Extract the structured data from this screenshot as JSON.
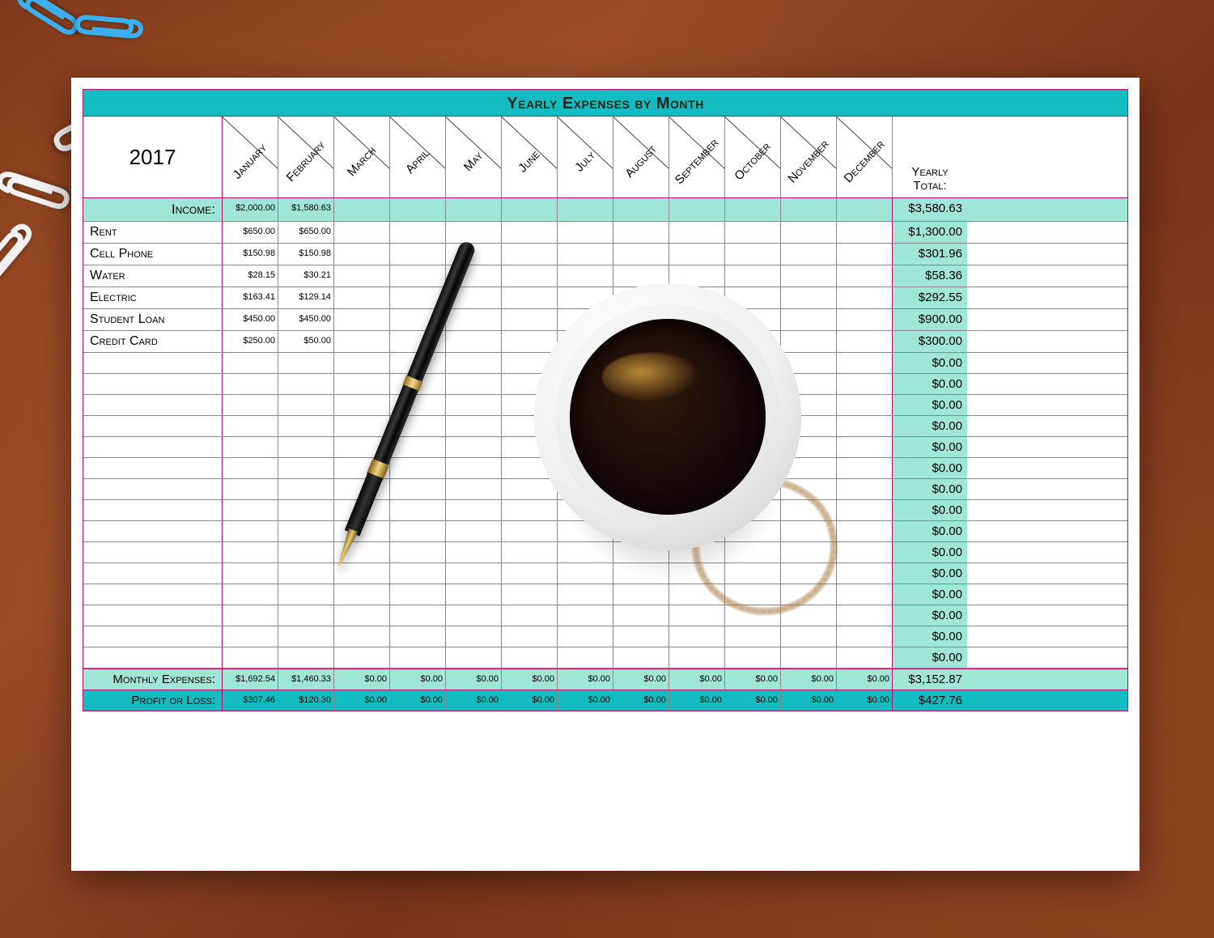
{
  "title": "Yearly Expenses by Month",
  "year": "2017",
  "months": [
    "January",
    "February",
    "March",
    "April",
    "May",
    "June",
    "July",
    "August",
    "September",
    "October",
    "November",
    "December"
  ],
  "total_head": {
    "line1": "Yearly",
    "line2": "Total:"
  },
  "income": {
    "label": "Income:",
    "values": [
      "$2,000.00",
      "$1,580.63",
      "",
      "",
      "",
      "",
      "",
      "",
      "",
      "",
      "",
      ""
    ],
    "total": "$3,580.63"
  },
  "expenses": [
    {
      "label": "Rent",
      "values": [
        "$650.00",
        "$650.00",
        "",
        "",
        "",
        "",
        "",
        "",
        "",
        "",
        "",
        ""
      ],
      "total": "$1,300.00"
    },
    {
      "label": "Cell Phone",
      "values": [
        "$150.98",
        "$150.98",
        "",
        "",
        "",
        "",
        "",
        "",
        "",
        "",
        "",
        ""
      ],
      "total": "$301.96"
    },
    {
      "label": "Water",
      "values": [
        "$28.15",
        "$30.21",
        "",
        "",
        "",
        "",
        "",
        "",
        "",
        "",
        "",
        ""
      ],
      "total": "$58.36"
    },
    {
      "label": "Electric",
      "values": [
        "$163.41",
        "$129.14",
        "",
        "",
        "",
        "",
        "",
        "",
        "",
        "",
        "",
        ""
      ],
      "total": "$292.55"
    },
    {
      "label": "Student Loan",
      "values": [
        "$450.00",
        "$450.00",
        "",
        "",
        "",
        "",
        "",
        "",
        "",
        "",
        "",
        ""
      ],
      "total": "$900.00"
    },
    {
      "label": "Credit Card",
      "values": [
        "$250.00",
        "$50.00",
        "",
        "",
        "",
        "",
        "",
        "",
        "",
        "",
        "",
        ""
      ],
      "total": "$300.00"
    },
    {
      "label": "",
      "values": [
        "",
        "",
        "",
        "",
        "",
        "",
        "",
        "",
        "",
        "",
        "",
        ""
      ],
      "total": "$0.00"
    },
    {
      "label": "",
      "values": [
        "",
        "",
        "",
        "",
        "",
        "",
        "",
        "",
        "",
        "",
        "",
        ""
      ],
      "total": "$0.00"
    },
    {
      "label": "",
      "values": [
        "",
        "",
        "",
        "",
        "",
        "",
        "",
        "",
        "",
        "",
        "",
        ""
      ],
      "total": "$0.00"
    },
    {
      "label": "",
      "values": [
        "",
        "",
        "",
        "",
        "",
        "",
        "",
        "",
        "",
        "",
        "",
        ""
      ],
      "total": "$0.00"
    },
    {
      "label": "",
      "values": [
        "",
        "",
        "",
        "",
        "",
        "",
        "",
        "",
        "",
        "",
        "",
        ""
      ],
      "total": "$0.00"
    },
    {
      "label": "",
      "values": [
        "",
        "",
        "",
        "",
        "",
        "",
        "",
        "",
        "",
        "",
        "",
        ""
      ],
      "total": "$0.00"
    },
    {
      "label": "",
      "values": [
        "",
        "",
        "",
        "",
        "",
        "",
        "",
        "",
        "",
        "",
        "",
        ""
      ],
      "total": "$0.00"
    },
    {
      "label": "",
      "values": [
        "",
        "",
        "",
        "",
        "",
        "",
        "",
        "",
        "",
        "",
        "",
        ""
      ],
      "total": "$0.00"
    },
    {
      "label": "",
      "values": [
        "",
        "",
        "",
        "",
        "",
        "",
        "",
        "",
        "",
        "",
        "",
        ""
      ],
      "total": "$0.00"
    },
    {
      "label": "",
      "values": [
        "",
        "",
        "",
        "",
        "",
        "",
        "",
        "",
        "",
        "",
        "",
        ""
      ],
      "total": "$0.00"
    },
    {
      "label": "",
      "values": [
        "",
        "",
        "",
        "",
        "",
        "",
        "",
        "",
        "",
        "",
        "",
        ""
      ],
      "total": "$0.00"
    },
    {
      "label": "",
      "values": [
        "",
        "",
        "",
        "",
        "",
        "",
        "",
        "",
        "",
        "",
        "",
        ""
      ],
      "total": "$0.00"
    },
    {
      "label": "",
      "values": [
        "",
        "",
        "",
        "",
        "",
        "",
        "",
        "",
        "",
        "",
        "",
        ""
      ],
      "total": "$0.00"
    },
    {
      "label": "",
      "values": [
        "",
        "",
        "",
        "",
        "",
        "",
        "",
        "",
        "",
        "",
        "",
        ""
      ],
      "total": "$0.00"
    },
    {
      "label": "",
      "values": [
        "",
        "",
        "",
        "",
        "",
        "",
        "",
        "",
        "",
        "",
        "",
        ""
      ],
      "total": "$0.00"
    }
  ],
  "monthly": {
    "label": "Monthly Expenses:",
    "values": [
      "$1,692.54",
      "$1,460.33",
      "$0.00",
      "$0.00",
      "$0.00",
      "$0.00",
      "$0.00",
      "$0.00",
      "$0.00",
      "$0.00",
      "$0.00",
      "$0.00"
    ],
    "total": "$3,152.87"
  },
  "profit": {
    "label": "Profit or Loss:",
    "values": [
      "$307.46",
      "$120.30",
      "$0.00",
      "$0.00",
      "$0.00",
      "$0.00",
      "$0.00",
      "$0.00",
      "$0.00",
      "$0.00",
      "$0.00",
      "$0.00"
    ],
    "total": "$427.76"
  },
  "chart_data": {
    "type": "table",
    "title": "Yearly Expenses by Month",
    "year": 2017,
    "columns": [
      "January",
      "February",
      "March",
      "April",
      "May",
      "June",
      "July",
      "August",
      "September",
      "October",
      "November",
      "December",
      "Yearly Total"
    ],
    "income": [
      2000.0,
      1580.63,
      null,
      null,
      null,
      null,
      null,
      null,
      null,
      null,
      null,
      null,
      3580.63
    ],
    "expense_rows": [
      {
        "name": "Rent",
        "values": [
          650.0,
          650.0,
          null,
          null,
          null,
          null,
          null,
          null,
          null,
          null,
          null,
          null
        ],
        "total": 1300.0
      },
      {
        "name": "Cell Phone",
        "values": [
          150.98,
          150.98,
          null,
          null,
          null,
          null,
          null,
          null,
          null,
          null,
          null,
          null
        ],
        "total": 301.96
      },
      {
        "name": "Water",
        "values": [
          28.15,
          30.21,
          null,
          null,
          null,
          null,
          null,
          null,
          null,
          null,
          null,
          null
        ],
        "total": 58.36
      },
      {
        "name": "Electric",
        "values": [
          163.41,
          129.14,
          null,
          null,
          null,
          null,
          null,
          null,
          null,
          null,
          null,
          null
        ],
        "total": 292.55
      },
      {
        "name": "Student Loan",
        "values": [
          450.0,
          450.0,
          null,
          null,
          null,
          null,
          null,
          null,
          null,
          null,
          null,
          null
        ],
        "total": 900.0
      },
      {
        "name": "Credit Card",
        "values": [
          250.0,
          50.0,
          null,
          null,
          null,
          null,
          null,
          null,
          null,
          null,
          null,
          null
        ],
        "total": 300.0
      }
    ],
    "monthly_expenses": [
      1692.54,
      1460.33,
      0,
      0,
      0,
      0,
      0,
      0,
      0,
      0,
      0,
      0,
      3152.87
    ],
    "profit_or_loss": [
      307.46,
      120.3,
      0,
      0,
      0,
      0,
      0,
      0,
      0,
      0,
      0,
      0,
      427.76
    ]
  }
}
